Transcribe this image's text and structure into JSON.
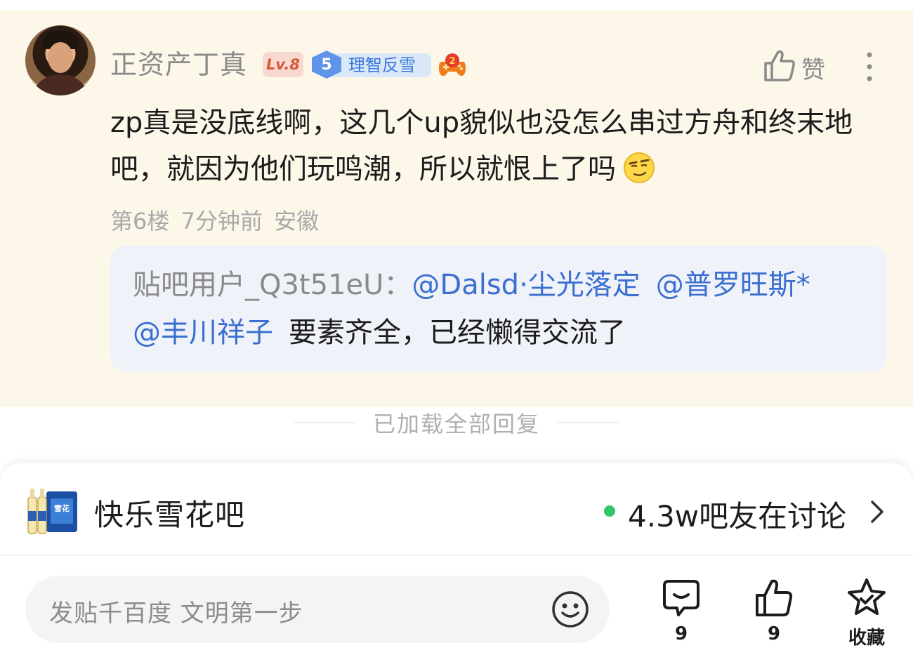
{
  "comment": {
    "username": "正资产丁真",
    "level_badge": "Lv.8",
    "fan_level": "5",
    "fan_badge_label": "理智反雪",
    "like_label": "赞",
    "text": "zp真是没底线啊，这几个up貌似也没怎么串过方舟和终末地吧，就因为他们玩鸣潮，所以就恨上了吗",
    "emoji_icon": "smug-face-emoji",
    "meta": "第6楼 7分钟前 安徽",
    "reply": {
      "author": "贴吧用户_Q3t51eU",
      "separator": "：",
      "mentions": [
        "@Dalsd·尘光落定",
        "@普罗旺斯*",
        "@丰川祥子"
      ],
      "text": "要素齐全，已经懒得交流了"
    }
  },
  "loaded_all": "已加载全部回复",
  "forum": {
    "name": "快乐雪花吧",
    "discussion": "4.3w吧友在讨论",
    "online_color": "#33c56b"
  },
  "composer": {
    "placeholder": "发贴千百度 文明第一步"
  },
  "actions": {
    "comment_count": "9",
    "like_count": "9",
    "favorite_label": "收藏"
  },
  "colors": {
    "card_background": "#fdf7ea",
    "reply_background": "#f0f2fa",
    "mention": "#3a6fd0"
  }
}
